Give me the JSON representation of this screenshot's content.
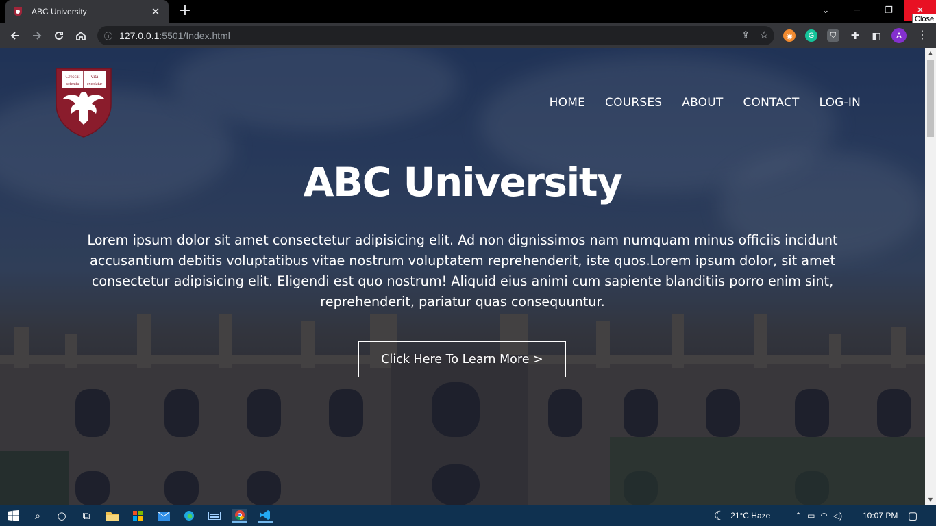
{
  "browser": {
    "tab_title": "ABC University",
    "tab_close": "✕",
    "new_tab": "+",
    "url_host": "127.0.0.1",
    "url_rest": ":5501/Index.html",
    "tooltip": "Close",
    "profile_initial": "A"
  },
  "site": {
    "nav": [
      "HOME",
      "COURSES",
      "ABOUT",
      "CONTACT",
      "LOG-IN"
    ],
    "hero_title": "ABC University",
    "hero_text": "Lorem ipsum dolor sit amet consectetur adipisicing elit. Ad non dignissimos nam numquam minus officiis incidunt accusantium debitis voluptatibus vitae nostrum voluptatem reprehenderit, iste quos.Lorem ipsum dolor, sit amet consectetur adipisicing elit. Eligendi est quo nostrum! Aliquid eius animi cum sapiente blanditiis porro enim sint, reprehenderit, pariatur quas consequuntur.",
    "hero_button": "Click Here To Learn More >",
    "logo_motto": [
      "Crescat",
      "scientia",
      "vita",
      "excolatur"
    ]
  },
  "taskbar": {
    "weather": "21°C  Haze",
    "time": "10:07 PM"
  },
  "colors": {
    "crest_red": "#8a1c2c",
    "taskbar": "#0f3150",
    "close_red": "#e81123"
  }
}
